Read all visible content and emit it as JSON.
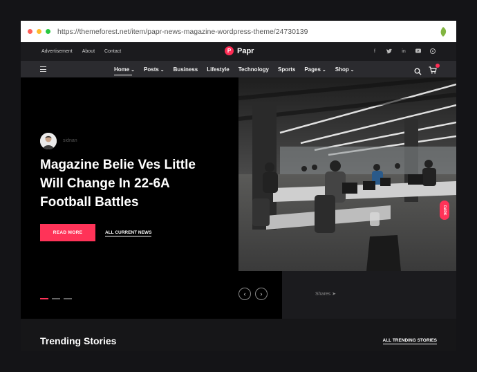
{
  "browser": {
    "url": "https://themeforest.net/item/papr-news-magazine-wordpress-theme/24730139"
  },
  "topbar": {
    "links": [
      "Advertisement",
      "About",
      "Contact"
    ],
    "logo_mark": "P",
    "logo_text": "Papr"
  },
  "nav": {
    "items": [
      {
        "label": "Home",
        "has_dropdown": true
      },
      {
        "label": "Posts",
        "has_dropdown": true
      },
      {
        "label": "Business",
        "has_dropdown": false
      },
      {
        "label": "Lifestyle",
        "has_dropdown": false
      },
      {
        "label": "Technology",
        "has_dropdown": false
      },
      {
        "label": "Sports",
        "has_dropdown": false
      },
      {
        "label": "Pages",
        "has_dropdown": true
      },
      {
        "label": "Shop",
        "has_dropdown": true
      }
    ]
  },
  "hero": {
    "author": "sidnan",
    "headline": "Magazine Belie Ves Little Will Change In 22-6A Football Battles",
    "read_more": "READ MORE",
    "all_news": "ALL CURRENT NEWS",
    "shares": "Shares",
    "dark_label": "DARK"
  },
  "trending": {
    "title": "Trending Stories",
    "all_label": "ALL TRENDING STORIES"
  },
  "colors": {
    "accent": "#ff3358",
    "background": "#000000",
    "navbar": "#2b2b2f"
  }
}
